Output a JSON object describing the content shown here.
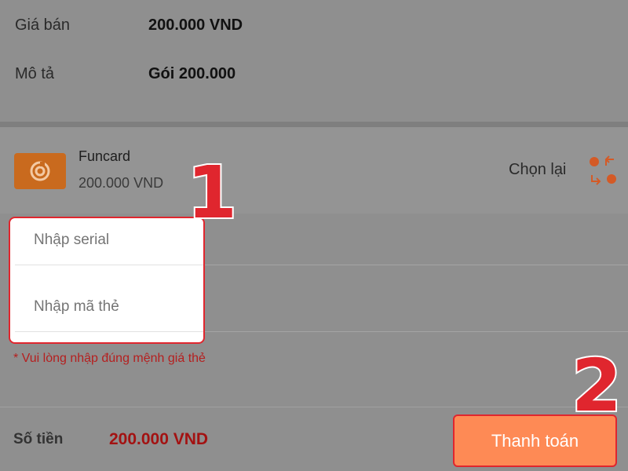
{
  "product": {
    "price_label": "Giá bán",
    "price_value": "200.000 VND",
    "desc_label": "Mô tả",
    "desc_value": "Gói 200.000"
  },
  "card": {
    "name": "Funcard",
    "price": "200.000 VND",
    "reselect_label": "Chọn lại",
    "logo_icon": "funcard-swirl-icon",
    "swap_icon": "swap-arrows-icon"
  },
  "form": {
    "serial_placeholder": "Nhập serial",
    "code_placeholder": "Nhập mã thẻ",
    "note": "* Vui lòng nhập đúng mệnh giá thẻ"
  },
  "footer": {
    "amount_label": "Số tiền",
    "amount_value": "200.000 VND",
    "pay_button": "Thanh toán"
  },
  "annotations": {
    "step1": "1",
    "step2": "2"
  },
  "colors": {
    "accent": "#fe8a55",
    "highlight": "#e0262e",
    "price_red": "#a31212"
  }
}
